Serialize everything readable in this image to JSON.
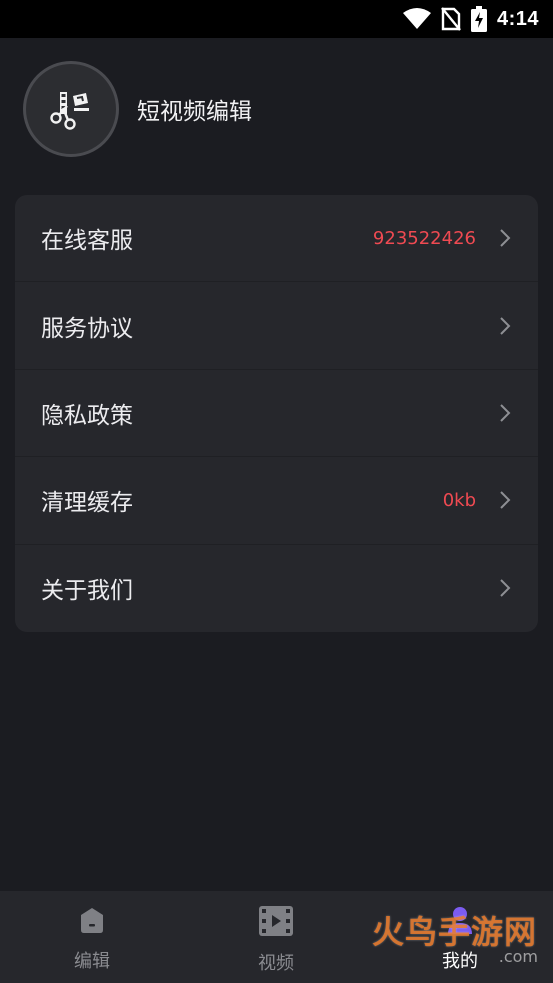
{
  "status_bar": {
    "time": "4:14"
  },
  "profile": {
    "app_name": "短视频编辑"
  },
  "menu": {
    "items": [
      {
        "label": "在线客服",
        "value": "923522426"
      },
      {
        "label": "服务协议",
        "value": ""
      },
      {
        "label": "隐私政策",
        "value": ""
      },
      {
        "label": "清理缓存",
        "value": "0kb"
      },
      {
        "label": "关于我们",
        "value": ""
      }
    ]
  },
  "tabbar": {
    "tabs": [
      {
        "label": "编辑",
        "icon": "home-icon"
      },
      {
        "label": "视频",
        "icon": "film-icon"
      },
      {
        "label": "我的",
        "icon": "user-icon",
        "active": true
      }
    ]
  },
  "watermark": {
    "main": "火鸟手游网",
    "sub": ".com"
  },
  "colors": {
    "background": "#1b1c21",
    "card": "#26272c",
    "accent_value": "#ef4a52",
    "active_tab_icon": "#7c5cf0"
  }
}
